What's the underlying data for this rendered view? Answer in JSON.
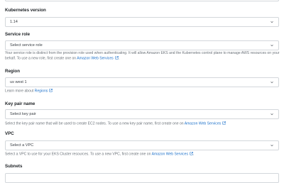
{
  "kubernetes_version": {
    "label": "Kubernetes version",
    "value": "1.14"
  },
  "service_role": {
    "label": "Service role",
    "value": "Select service role",
    "help_text": "Your service role is distinct from the provision role used when authenticating. It will allow Amazon EKS and the Kubernetes control plane to manage AWS resources on your behalf. To use a new role, first create one on",
    "help_link": "Amazon Web Services",
    "help_suffix": "."
  },
  "region": {
    "label": "Region",
    "value": "us west 1",
    "help_text": "Learn more about",
    "help_link": "Regions"
  },
  "key_pair": {
    "label": "Key pair name",
    "value": "Select key pair",
    "help_text": "Select the key pair name that will be used to create EC2 nodes. To use a new key pair name, first create one on",
    "help_link": "Amazon Web Services"
  },
  "vpc": {
    "label": "VPC",
    "value": "Select a VPC",
    "help_text": "Select a VPC to use for your EKS Cluster resources. To use a new VPC, first create one on",
    "help_link": "Amazon Web Services",
    "help_suffix": "."
  },
  "subnets": {
    "label": "Subnets"
  },
  "colors": {
    "link": "#1a6fc9",
    "border": "#d3d7db",
    "help_text": "#6a7178"
  }
}
